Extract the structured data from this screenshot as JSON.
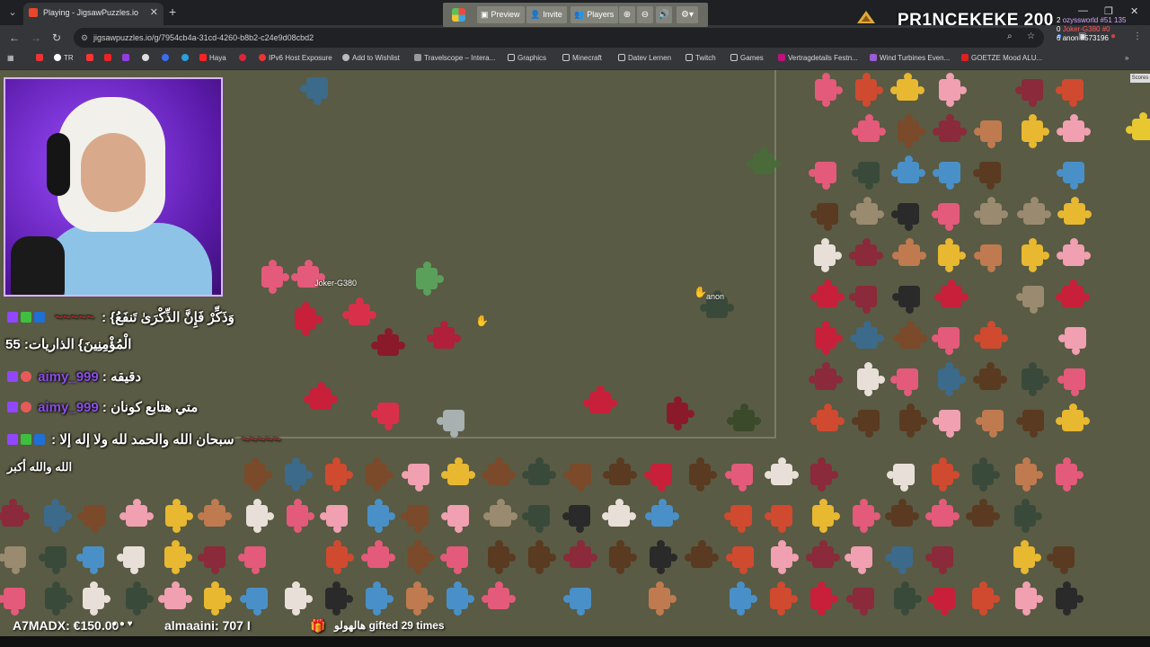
{
  "browser": {
    "tab_title": "Playing - JigsawPuzzles.io",
    "url": "jigsawpuzzles.io/g/7954cb4a-31cd-4260-b8b2-c24e9d08cbd2",
    "bookmarks": [
      "TR",
      "Haya",
      "IPv6 Host Exposure",
      "Add to Wishlist",
      "Travelscope – Intera...",
      "Graphics",
      "Minecraft",
      "Datev Lernen",
      "Twitch",
      "Games",
      "Vertragdetails Festn...",
      "Wind Turbines Even...",
      "GOETZE Mood ALU..."
    ]
  },
  "stream_overlay": {
    "brand_name": "PR1NCEKEKE",
    "brand_count": "200"
  },
  "toolbar": {
    "preview_label": "Preview",
    "invite_label": "Invite",
    "players_label": "Players"
  },
  "players": {
    "label_1": "Joker-G380",
    "label_2": "anon"
  },
  "scores": {
    "button_label": "Scores",
    "rows": [
      {
        "rank": "2",
        "name": "ozyssworld #51 135"
      },
      {
        "rank": "0",
        "name": "Joker-G380 #0"
      },
      {
        "rank": "6",
        "name": "anon #573196"
      }
    ]
  },
  "chat": {
    "line1_prefix": ":",
    "line1_text": "{وَذَكِّرْ فَإِنَّ الذِّكْرَىٰ تَنفَعُ",
    "line2_text": "الْمُؤْمِنِينَ} الذاريات: 55",
    "line3_user": "aimy_999",
    "line3_text": ": دقيقه",
    "line4_user": "aimy_999",
    "line4_text": ": متي هتابع كونان",
    "line5_text": ": سبحان الله والحمد لله ولا إله إلا",
    "line6_text": "الله والله أكبر"
  },
  "ticker": {
    "item1": "A7MADX: €150.00",
    "item2": "almaaini: 707 I",
    "item3": "هالهولو gifted 29 times"
  },
  "colors": {
    "table": "#595b44",
    "board_border": "#7a7c66",
    "toolbar": "#696b62",
    "webcam_border": "#d9b6ff"
  }
}
